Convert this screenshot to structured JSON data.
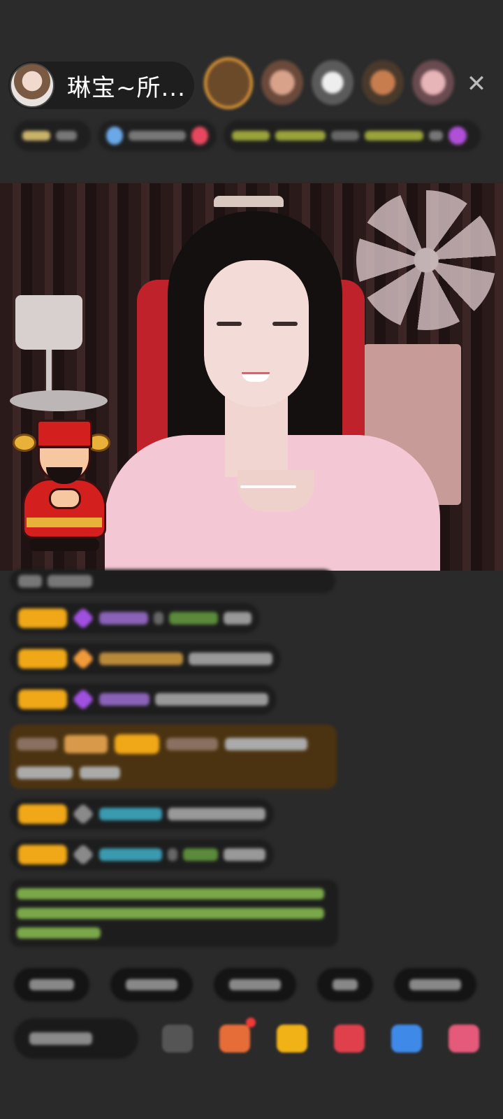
{
  "header": {
    "host_name": "琳宝~所...",
    "close_symbol": "✕",
    "viewer_count": 5
  },
  "colors": {
    "badge": "#f0a818",
    "highlight_message_bg": "#4b3311",
    "notice_text": "#9cc84a",
    "purple_gem": "#a050e0",
    "orange_gem": "#f09a3a"
  },
  "chat": {
    "message_count": 9
  },
  "bottom_bar": {
    "tools": [
      "emoji-icon",
      "gift-icon",
      "treasure-box-icon",
      "red-envelope-icon",
      "game-icon",
      "more-grid-icon"
    ]
  }
}
